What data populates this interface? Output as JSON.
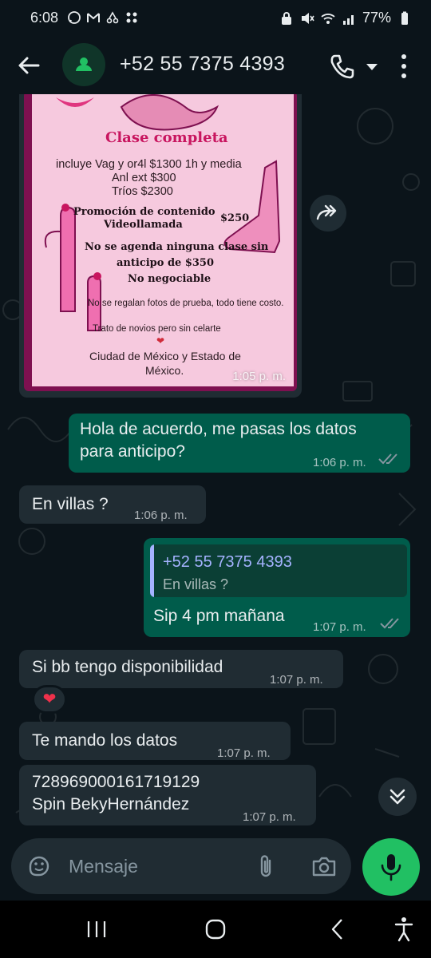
{
  "status_bar": {
    "time": "6:08",
    "battery": "77%",
    "icons_left": [
      "whatsapp-icon",
      "gmail-icon",
      "shipping-icon",
      "apps-icon"
    ],
    "icons_right": [
      "lock-icon",
      "mute-icon",
      "wifi-icon",
      "signal-icon",
      "battery-icon"
    ]
  },
  "header": {
    "contact": "+52 55 7375 4393",
    "icons": [
      "back-arrow-icon",
      "avatar-icon",
      "phone-icon",
      "chevron-down-icon",
      "more-vert-icon"
    ]
  },
  "poster": {
    "title": "Clase completa",
    "line1": "incluye Vag y or4l $1300   1h y media",
    "line2": "Anl ext $300",
    "line3": "Tríos $2300",
    "promo": "Promoción de contenido",
    "promo_price": "$250",
    "video": "Videollamada",
    "rule1": "No se agenda ninguna clase sin",
    "rule2": "anticipo de $350",
    "rule3": "No negociable",
    "note1": "No se regalan fotos de prueba, todo tiene costo.",
    "note2": "Trato de novios pero sin celarte",
    "location1": "Ciudad de México y Estado de",
    "location2": "México."
  },
  "messages": [
    {
      "type": "image",
      "direction": "incoming",
      "time": "1:05 p. m."
    },
    {
      "type": "text",
      "direction": "outgoing",
      "line1": "Hola de acuerdo, me pasas los datos",
      "line2": "para anticipo?",
      "time": "1:06 p. m.",
      "read": true
    },
    {
      "type": "text",
      "direction": "incoming",
      "text": "En villas ?",
      "time": "1:06 p. m."
    },
    {
      "type": "reply",
      "direction": "outgoing",
      "quoted_name": "+52 55 7375 4393",
      "quoted_text": "En villas ?",
      "text": "Sip 4 pm mañana",
      "time": "1:07 p. m.",
      "read": true
    },
    {
      "type": "text",
      "direction": "incoming",
      "text": "Si bb tengo disponibilidad",
      "time": "1:07 p. m.",
      "reaction": "❤"
    },
    {
      "type": "text",
      "direction": "incoming",
      "text": "Te mando los datos",
      "time": "1:07 p. m."
    },
    {
      "type": "text",
      "direction": "incoming",
      "line1": "728969000161719129",
      "line2": "Spin BekyHernández",
      "time": "1:07 p. m."
    }
  ],
  "composer": {
    "placeholder": "Mensaje",
    "icons": [
      "sticker-icon",
      "paperclip-icon",
      "camera-icon",
      "mic-icon"
    ]
  },
  "nav_bar": {
    "icons": [
      "recent-apps-icon",
      "home-icon",
      "back-icon",
      "accessibility-icon"
    ]
  },
  "colors": {
    "background": "#0b141a",
    "incoming_bubble": "#202c33",
    "outgoing_bubble": "#005c4b",
    "accent_green": "#21c063",
    "read_ticks": "#8696a0",
    "quote_name": "#a5b3ff",
    "poster_pink": "#f6c9de",
    "poster_border": "#7e1050"
  }
}
